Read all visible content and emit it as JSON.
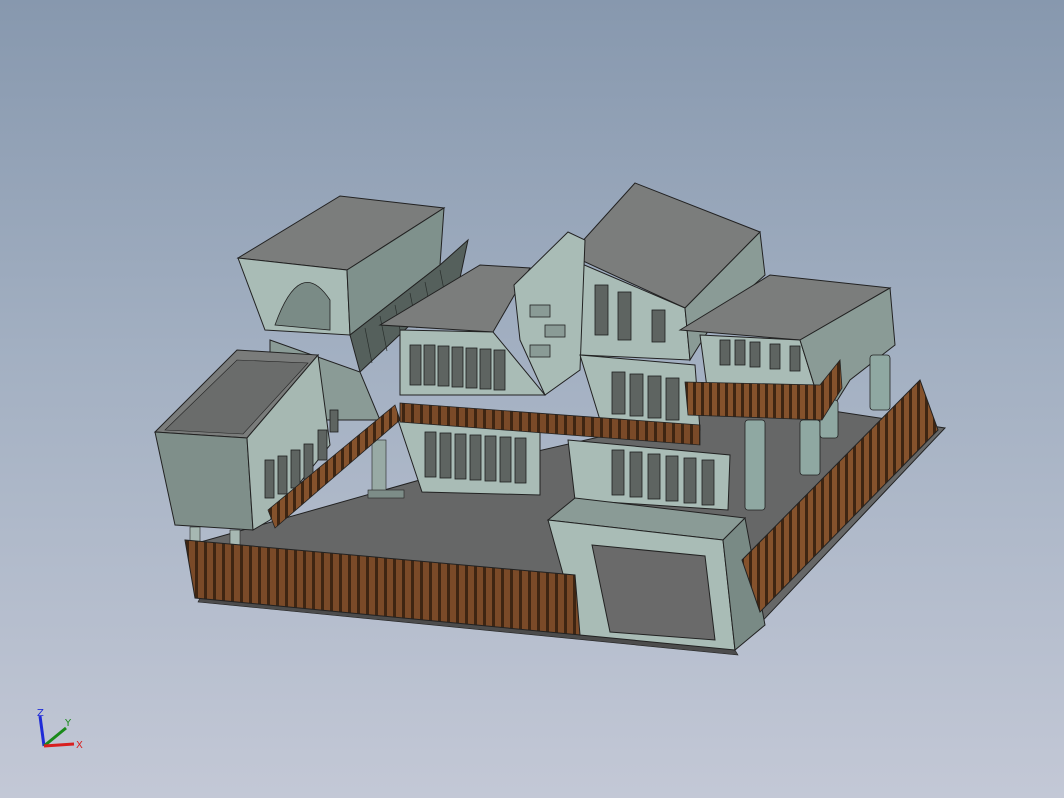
{
  "viewport": {
    "background_top": "#8798ae",
    "background_bottom": "#c3c8d6"
  },
  "model": {
    "wall_color": "#9fb3ad",
    "wall_shade": "#6f7f7a",
    "roof_color": "#7a7c7b",
    "floor_color": "#6a6a6a",
    "fence_color": "#7a4a28",
    "window_color": "#5e6461"
  },
  "triad": {
    "z_label": "Z",
    "y_label": "Y",
    "x_label": "X",
    "z_color": "#1f2bd8",
    "y_color": "#1a8a1a",
    "x_color": "#d81f1f"
  }
}
